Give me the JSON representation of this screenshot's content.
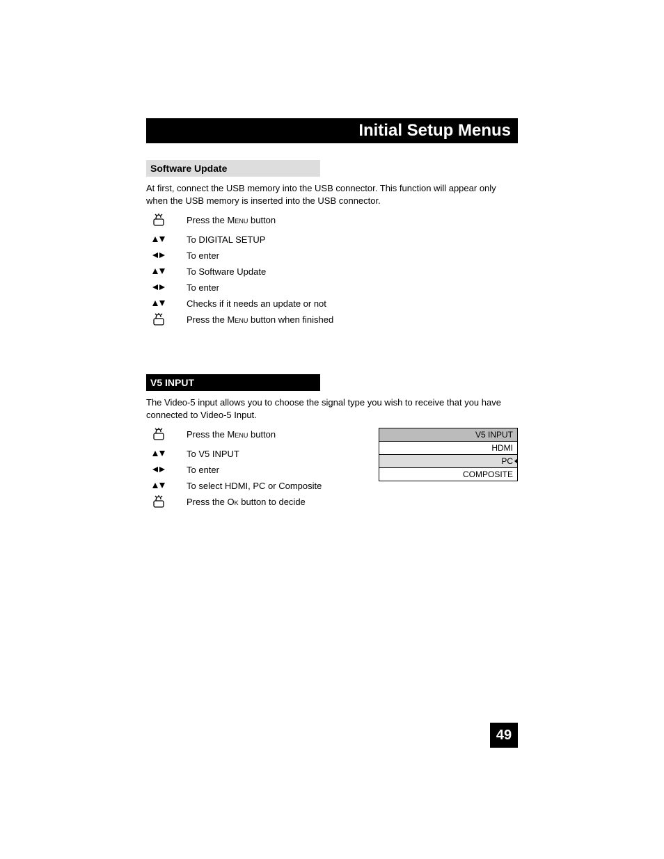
{
  "title": "Initial Setup Menus",
  "page_number": "49",
  "section1": {
    "heading": "Software Update",
    "intro": "At first, connect the USB memory into the USB connector.  This function will appear only when the USB memory is inserted into the USB connector.",
    "steps": [
      {
        "icon": "hand",
        "pre": "Press the ",
        "sc": "Menu",
        "post": " button"
      },
      {
        "icon": "ud",
        "pre": "To DIGITAL SETUP",
        "sc": "",
        "post": ""
      },
      {
        "icon": "lr",
        "pre": "To enter",
        "sc": "",
        "post": ""
      },
      {
        "icon": "ud",
        "pre": "To Software Update",
        "sc": "",
        "post": ""
      },
      {
        "icon": "lr",
        "pre": "To enter",
        "sc": "",
        "post": ""
      },
      {
        "icon": "ud",
        "pre": "Checks if it needs an update or not",
        "sc": "",
        "post": ""
      },
      {
        "icon": "hand",
        "pre": "Press the ",
        "sc": "Menu",
        "post": " button when finished"
      }
    ]
  },
  "section2": {
    "heading": "V5 INPUT",
    "intro": "The Video-5 input allows you to choose the signal type you wish to receive that you have connected to Video-5 Input.",
    "steps": [
      {
        "icon": "hand",
        "pre": "Press the ",
        "sc": "Menu",
        "post": " button"
      },
      {
        "icon": "ud",
        "pre": "To V5 INPUT",
        "sc": "",
        "post": ""
      },
      {
        "icon": "lr",
        "pre": "To enter",
        "sc": "",
        "post": ""
      },
      {
        "icon": "ud",
        "pre": "To select HDMI, PC or Composite",
        "sc": "",
        "post": ""
      },
      {
        "icon": "hand",
        "pre": "Press the ",
        "sc": "Ok",
        "post": " button to decide"
      }
    ],
    "menu": {
      "header": "V5 INPUT",
      "rows": [
        {
          "label": "HDMI",
          "selected": false
        },
        {
          "label": "PC",
          "selected": true
        },
        {
          "label": "COMPOSITE",
          "selected": false
        }
      ]
    }
  }
}
